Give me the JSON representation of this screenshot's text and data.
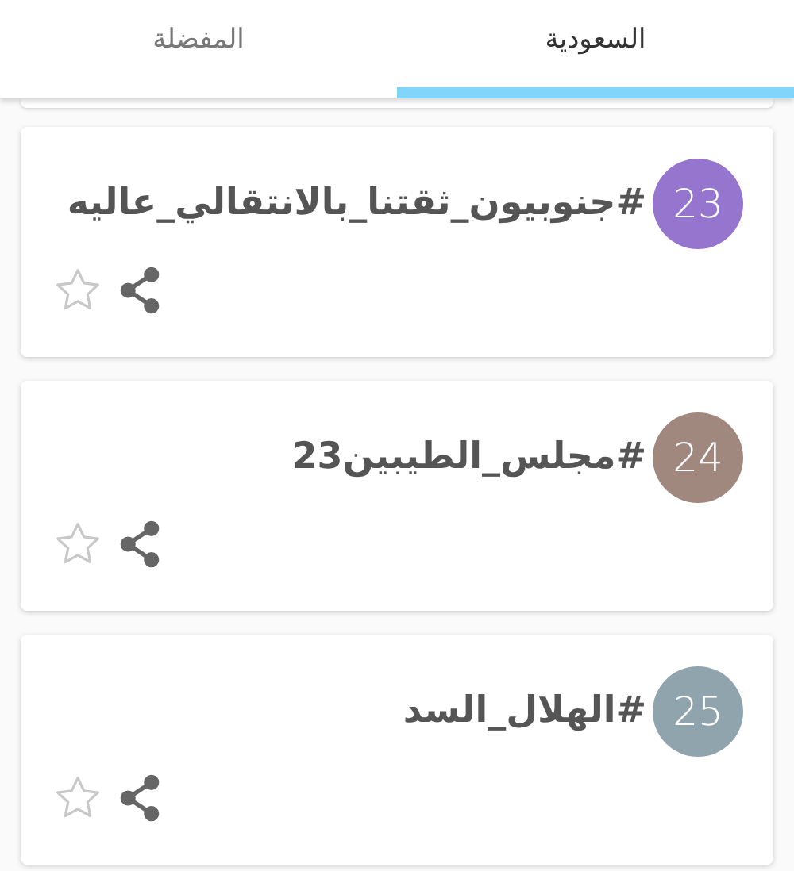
{
  "tabs": [
    {
      "label": "السعودية",
      "selected": true
    },
    {
      "label": "المفضلة",
      "selected": false
    }
  ],
  "trends": [
    {
      "rank": "23",
      "tag": "#جنوبيون_ثقتنا_بالانتقالي_عاليه",
      "color": "#9575cd",
      "starred": false
    },
    {
      "rank": "24",
      "tag": "#مجلس_الطيبين23",
      "color": "#a1887f",
      "starred": false
    },
    {
      "rank": "25",
      "tag": "#الهلال_السد",
      "color": "#90a4ae",
      "starred": false
    }
  ]
}
